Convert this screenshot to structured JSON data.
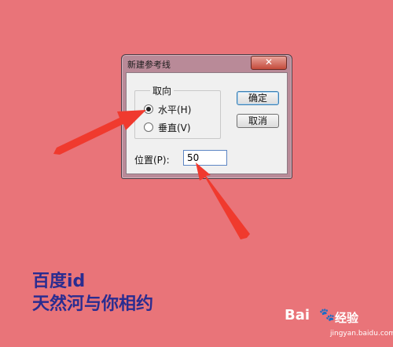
{
  "dialog": {
    "title": "新建参考线",
    "close_label": "✕",
    "orientation_group_label": "取向",
    "options": [
      {
        "label": "水平(H)",
        "checked": true
      },
      {
        "label": "垂直(V)",
        "checked": false
      }
    ],
    "ok_label": "确定",
    "cancel_label": "取消",
    "position_label": "位置(P):",
    "position_value": "50"
  },
  "watermark": {
    "line1": "百度id",
    "line2": "天然河与你相约"
  },
  "baidu_logo": {
    "brand": "Bai",
    "brand_suffix": "经验",
    "url": "jingyan.baidu.com"
  },
  "colors": {
    "background": "#e97479",
    "arrow": "#f03a2e",
    "watermark_text": "#2a2c90"
  }
}
